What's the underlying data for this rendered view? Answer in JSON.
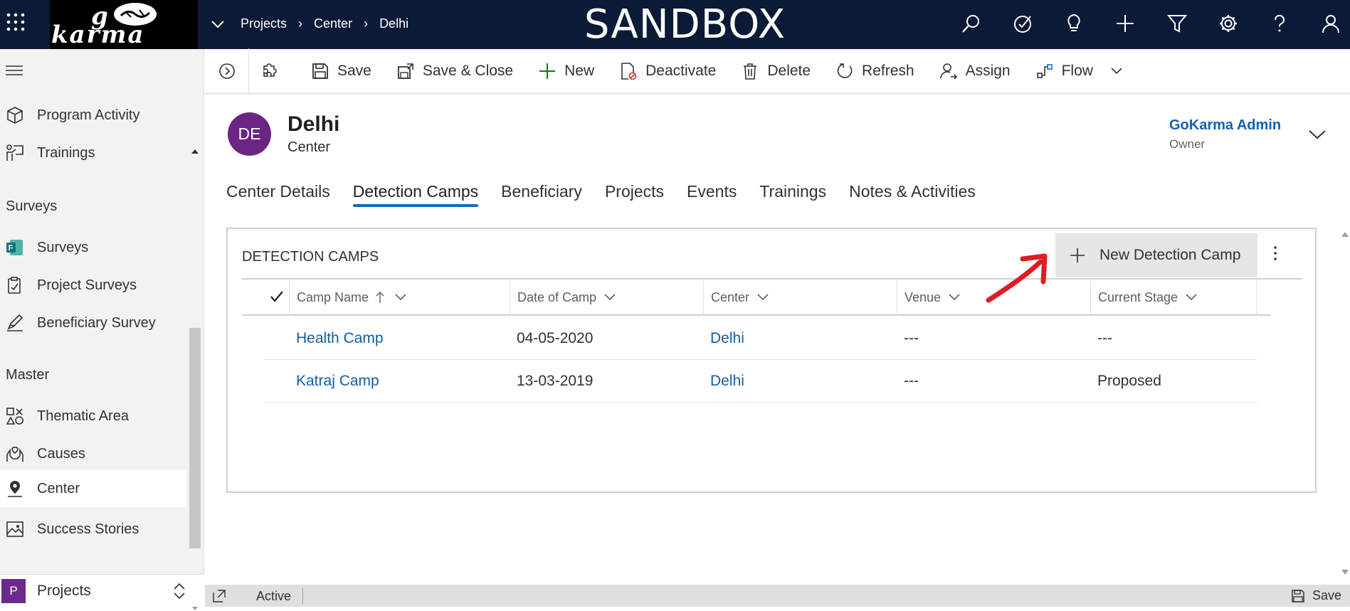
{
  "topbar": {
    "breadcrumb": [
      "Projects",
      "Center",
      "Delhi"
    ],
    "environment": "SANDBOX",
    "icons": [
      "search-icon",
      "task-icon",
      "lightbulb-icon",
      "plus-icon",
      "filter-icon",
      "gear-icon",
      "help-icon",
      "user-icon"
    ],
    "background": "#0b1a36"
  },
  "sidebar": {
    "items_top": [
      {
        "label": "Program Activity",
        "icon": "box-icon"
      },
      {
        "label": "Trainings",
        "icon": "presentation-icon"
      }
    ],
    "groups": [
      {
        "title": "Surveys",
        "items": [
          {
            "label": "Surveys",
            "icon": "forms-icon"
          },
          {
            "label": "Project Surveys",
            "icon": "clipboard-icon"
          },
          {
            "label": "Beneficiary Survey",
            "icon": "edit-icon"
          }
        ]
      },
      {
        "title": "Master",
        "items": [
          {
            "label": "Thematic Area",
            "icon": "shapes-icon"
          },
          {
            "label": "Causes",
            "icon": "hands-icon"
          },
          {
            "label": "Center",
            "icon": "location-icon"
          },
          {
            "label": "Success Stories",
            "icon": "image-icon"
          }
        ]
      }
    ],
    "active_item": "Center",
    "area": {
      "badge": "P",
      "label": "Projects"
    }
  },
  "commandbar": {
    "save": "Save",
    "save_close": "Save & Close",
    "new": "New",
    "deactivate": "Deactivate",
    "delete": "Delete",
    "refresh": "Refresh",
    "assign": "Assign",
    "flow": "Flow"
  },
  "header": {
    "initials": "DE",
    "title": "Delhi",
    "entity": "Center",
    "owner_name": "GoKarma Admin",
    "owner_label": "Owner",
    "avatar_color": "#6b2585"
  },
  "tabs": [
    "Center Details",
    "Detection Camps",
    "Beneficiary",
    "Projects",
    "Events",
    "Trainings",
    "Notes & Activities"
  ],
  "active_tab": "Detection Camps",
  "subgrid": {
    "title": "DETECTION CAMPS",
    "new_button": "New Detection Camp",
    "columns": [
      "Camp Name",
      "Date of Camp",
      "Center",
      "Venue",
      "Current Stage"
    ],
    "rows": [
      {
        "camp_name": "Health Camp",
        "date": "04-05-2020",
        "center": "Delhi",
        "venue": "---",
        "stage": "---"
      },
      {
        "camp_name": "Katraj Camp",
        "date": "13-03-2019",
        "center": "Delhi",
        "venue": "---",
        "stage": "Proposed"
      }
    ]
  },
  "footer": {
    "status": "Active",
    "save": "Save"
  },
  "accent_color": "#0f6cbd",
  "annotation_color": "#e01b24"
}
